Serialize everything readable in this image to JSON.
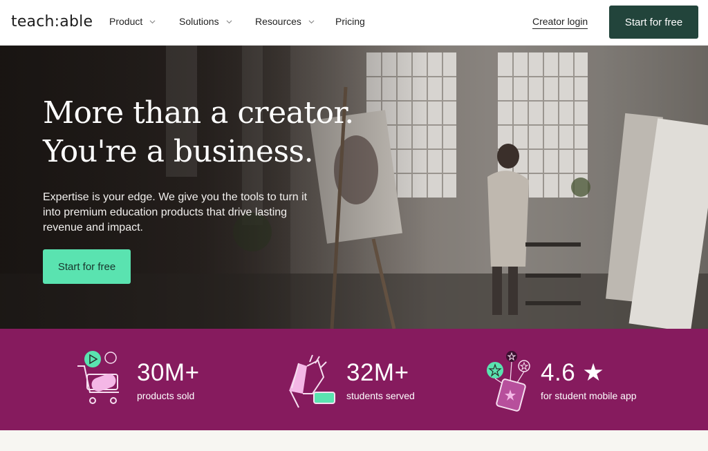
{
  "nav": {
    "logo": "teach:able",
    "items": [
      {
        "label": "Product"
      },
      {
        "label": "Solutions"
      },
      {
        "label": "Resources"
      },
      {
        "label": "Pricing"
      }
    ],
    "creator_login": "Creator login",
    "start_free": "Start for free"
  },
  "hero": {
    "title_line1": "More than a creator.",
    "title_line2": "You're a business.",
    "subtitle": "Expertise is your edge. We give you the tools to turn it into premium education products that drive lasting revenue and impact.",
    "cta": "Start for free"
  },
  "stats": [
    {
      "value": "30M+",
      "label": "products sold",
      "icon": "shopping-cart-icon"
    },
    {
      "value": "32M+",
      "label": "students served",
      "icon": "high-five-icon"
    },
    {
      "value": "4.6 ★",
      "label": "for student mobile app",
      "icon": "mobile-rating-icon"
    }
  ],
  "colors": {
    "brand_dark": "#22443b",
    "accent_green": "#5ae3b0",
    "stats_band": "#861b5e"
  }
}
